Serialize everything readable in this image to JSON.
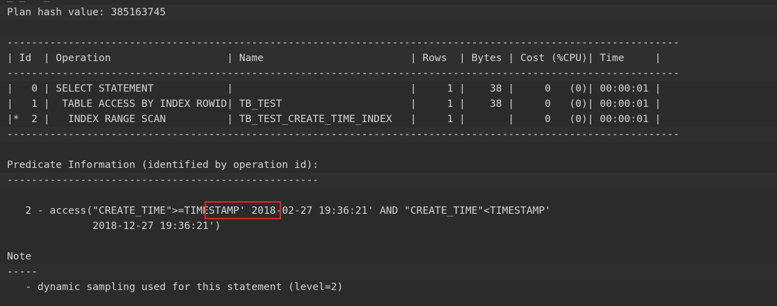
{
  "plan": {
    "hash_line": "Plan hash value: 385163745",
    "separator": "--------------------------------------------------------------------------------------------------------------",
    "header": "| Id  | Operation                   | Name                        | Rows  | Bytes | Cost (%CPU)| Time     |",
    "rows": [
      "|   0 | SELECT STATEMENT            |                             |     1 |    38 |     0   (0)| 00:00:01 |",
      "|   1 |  TABLE ACCESS BY INDEX ROWID| TB_TEST                     |     1 |    38 |     0   (0)| 00:00:01 |",
      "|*  2 |   INDEX RANGE SCAN          | TB_TEST_CREATE_TIME_INDEX   |     1 |       |     0   (0)| 00:00:01 |"
    ]
  },
  "predicate": {
    "title": "Predicate Information (identified by operation id):",
    "underline": "---------------------------------------------------",
    "line1": "   2 - access(\"CREATE_TIME\">=TIMESTAMP' 2018-02-27 19:36:21' AND \"CREATE_TIME\"<TIMESTAMP'",
    "line2": "              2018-12-27 19:36:21')"
  },
  "note": {
    "title": "Note",
    "underline": "-----",
    "text": "   - dynamic sampling used for this statement (level=2)"
  },
  "highlight_color": "#e0262a"
}
